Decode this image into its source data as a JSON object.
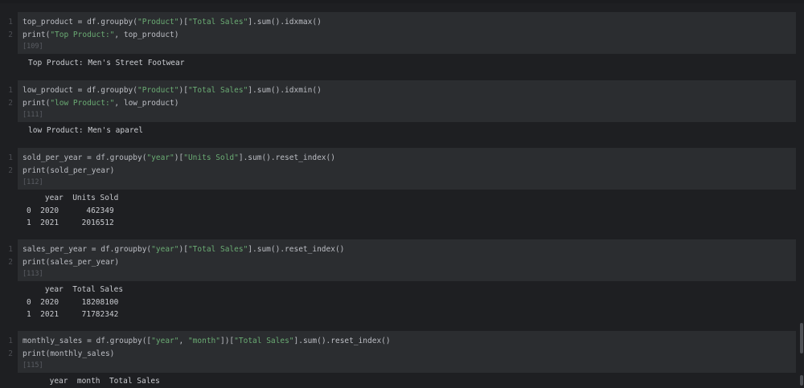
{
  "cells": [
    {
      "lines": [
        [
          "top_product = df.groupby(",
          "\"Product\"",
          ")[",
          "\"Total Sales\"",
          "].sum().idxmax()"
        ],
        [
          "print(",
          "\"Top Product:\"",
          ", top_product)"
        ]
      ],
      "count": "[109]",
      "output": "Top Product: Men's Street Footwear"
    },
    {
      "lines": [
        [
          "low_product = df.groupby(",
          "\"Product\"",
          ")[",
          "\"Total Sales\"",
          "].sum().idxmin()"
        ],
        [
          "print(",
          "\"low Product:\"",
          ", low_product)"
        ]
      ],
      "count": "[111]",
      "output": "low Product: Men's aparel"
    },
    {
      "lines": [
        [
          "sold_per_year = df.groupby(",
          "\"year\"",
          ")[",
          "\"Units Sold\"",
          "].sum().reset_index()"
        ],
        [
          "print(sold_per_year)"
        ]
      ],
      "count": "[112]",
      "output": "    year  Units Sold\n0  2020      462349\n1  2021     2016512"
    },
    {
      "lines": [
        [
          "sales_per_year = df.groupby(",
          "\"year\"",
          ")[",
          "\"Total Sales\"",
          "].sum().reset_index()"
        ],
        [
          "print(sales_per_year)"
        ]
      ],
      "count": "[113]",
      "output": "    year  Total Sales\n0  2020     18208100\n1  2021     71782342"
    },
    {
      "lines": [
        [
          "monthly_sales = df.groupby([",
          "\"year\"",
          ", ",
          "\"month\"",
          "])[",
          "\"Total Sales\"",
          "].sum().reset_index()"
        ],
        [
          "print(monthly_sales)"
        ]
      ],
      "count": "[115]",
      "output": "     year  month  Total Sales"
    }
  ],
  "line_numbers": [
    "1",
    "2"
  ]
}
